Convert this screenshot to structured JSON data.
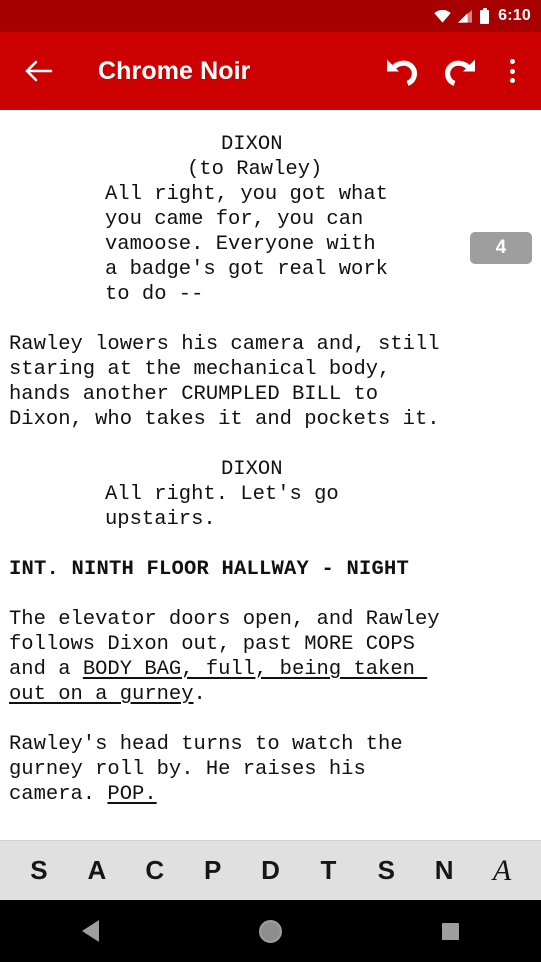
{
  "status_bar": {
    "time": "6:10",
    "icons": [
      "wifi-icon",
      "cell-signal-icon",
      "battery-icon"
    ],
    "background_color": "#a60000"
  },
  "app_bar": {
    "background_color": "#cc0000",
    "back_label": "back-arrow-icon",
    "title": "Chrome Noir",
    "actions": [
      {
        "name": "undo-button",
        "label": "Undo"
      },
      {
        "name": "redo-button",
        "label": "Redo"
      },
      {
        "name": "overflow-menu-button",
        "label": "More options"
      }
    ]
  },
  "document": {
    "page_badge": "4",
    "page_badge_color": "#9e9e9e",
    "blocks": [
      {
        "type": "character",
        "text": "DIXON"
      },
      {
        "type": "parenthetical",
        "text": "(to Rawley)"
      },
      {
        "type": "dialogue",
        "text": "All right, you got what\nyou came for, you can\nvamoose. Everyone with\na badge's got real work\nto do --"
      },
      {
        "type": "action",
        "text": "Rawley lowers his camera and, still\nstaring at the mechanical body,\nhands another CRUMPLED BILL to\nDixon, who takes it and pockets it."
      },
      {
        "type": "character",
        "text": "DIXON"
      },
      {
        "type": "dialogue",
        "text": "All right. Let's go\nupstairs."
      },
      {
        "type": "scene_heading",
        "text": "INT. NINTH FLOOR HALLWAY - NIGHT"
      },
      {
        "type": "action_rich",
        "segments": [
          {
            "text": "The elevator doors open, and Rawley\nfollows Dixon out, past MORE COPS\nand a ",
            "underline": false
          },
          {
            "text": "BODY BAG, full, being taken \nout on a gurney",
            "underline": true
          },
          {
            "text": ".",
            "underline": false
          }
        ]
      },
      {
        "type": "action_rich",
        "segments": [
          {
            "text": "Rawley's head turns to watch the\ngurney roll by. He raises his\ncamera. ",
            "underline": false
          },
          {
            "text": "POP.",
            "underline": true
          }
        ]
      }
    ]
  },
  "format_toolbar": {
    "background_color": "#e0e0e0",
    "buttons": [
      {
        "name": "format-scene-heading",
        "label": "S"
      },
      {
        "name": "format-action",
        "label": "A"
      },
      {
        "name": "format-character",
        "label": "C"
      },
      {
        "name": "format-parenthetical",
        "label": "P"
      },
      {
        "name": "format-dialogue",
        "label": "D"
      },
      {
        "name": "format-transition",
        "label": "T"
      },
      {
        "name": "format-shot",
        "label": "S"
      },
      {
        "name": "format-note",
        "label": "N"
      },
      {
        "name": "format-italic",
        "label": "A"
      }
    ]
  },
  "navigation_bar": {
    "background_color": "#000000",
    "buttons": [
      {
        "name": "nav-back-button",
        "label": "Back"
      },
      {
        "name": "nav-home-button",
        "label": "Home"
      },
      {
        "name": "nav-recents-button",
        "label": "Recents"
      }
    ]
  }
}
